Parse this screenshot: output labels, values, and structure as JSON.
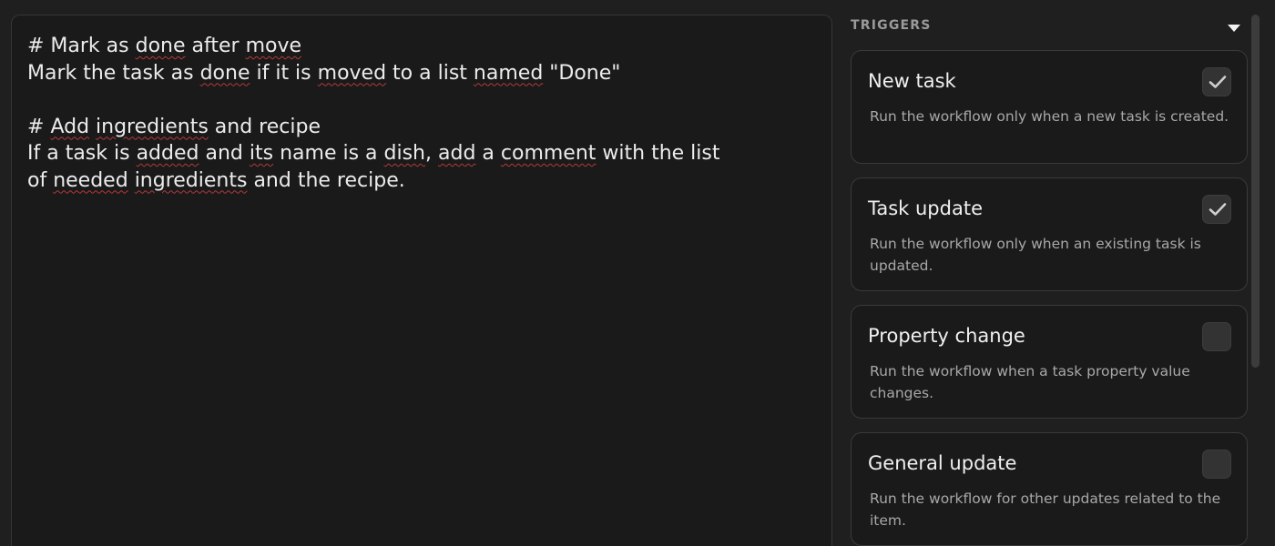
{
  "editor": {
    "lines": [
      [
        {
          "t": "# Mark as "
        },
        {
          "t": "done",
          "err": true
        },
        {
          "t": " after "
        },
        {
          "t": "move",
          "err": true
        }
      ],
      [
        {
          "t": "Mark the task as "
        },
        {
          "t": "done",
          "err": true
        },
        {
          "t": " if it is "
        },
        {
          "t": "moved",
          "err": true
        },
        {
          "t": " to a list "
        },
        {
          "t": "named",
          "err": true
        },
        {
          "t": " \"Done\""
        }
      ],
      [],
      [
        {
          "t": "# "
        },
        {
          "t": "Add",
          "err": true
        },
        {
          "t": " "
        },
        {
          "t": "ingredients",
          "err": true
        },
        {
          "t": " and recipe"
        }
      ],
      [
        {
          "t": "If a task is "
        },
        {
          "t": "added",
          "err": true
        },
        {
          "t": " and "
        },
        {
          "t": "its",
          "err": true
        },
        {
          "t": " name is a "
        },
        {
          "t": "dish",
          "err": true
        },
        {
          "t": ", "
        },
        {
          "t": "add",
          "err": true
        },
        {
          "t": " a "
        },
        {
          "t": "comment",
          "err": true
        },
        {
          "t": " with the list"
        }
      ],
      [
        {
          "t": "of "
        },
        {
          "t": "needed",
          "err": true
        },
        {
          "t": " "
        },
        {
          "t": "ingredients",
          "err": true
        },
        {
          "t": " and the recipe."
        }
      ]
    ]
  },
  "triggers": {
    "title": "TRIGGERS",
    "collapse_icon": "caret-down-icon",
    "cards": [
      {
        "title": "New task",
        "description": "Run the workflow only when a new task is created.",
        "checked": true
      },
      {
        "title": "Task update",
        "description": "Run the workflow only when an existing task is updated.",
        "checked": true
      },
      {
        "title": "Property change",
        "description": "Run the workflow when a task property value changes.",
        "checked": false
      },
      {
        "title": "General update",
        "description": "Run the workflow for other updates related to the item.",
        "checked": false
      }
    ]
  },
  "colors": {
    "background": "#1f1f1f",
    "panel": "#1a1a1a",
    "border": "#363636",
    "spellcheck": "#b23a3a",
    "checkbox": "#333333",
    "checkmark": "#cfcfcf"
  }
}
